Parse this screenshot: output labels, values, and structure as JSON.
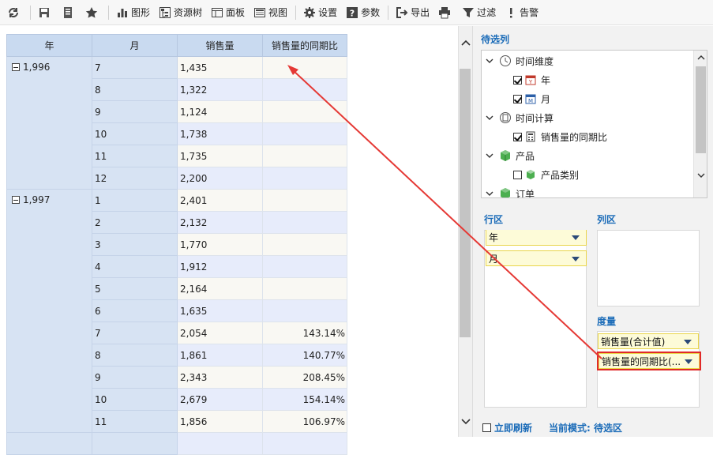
{
  "toolbar": {
    "items": [
      {
        "icon": "refresh-icon",
        "label": ""
      },
      {
        "icon": "save-icon",
        "label": ""
      },
      {
        "icon": "save-as-icon",
        "label": ""
      },
      {
        "icon": "star-icon",
        "label": ""
      },
      {
        "icon": "chart-icon",
        "label": "图形"
      },
      {
        "icon": "resource-tree-icon",
        "label": "资源树"
      },
      {
        "icon": "panel-icon",
        "label": "面板"
      },
      {
        "icon": "view-icon",
        "label": "视图"
      },
      {
        "icon": "gear-icon",
        "label": "设置"
      },
      {
        "icon": "help-icon",
        "label": "参数"
      },
      {
        "icon": "export-icon",
        "label": "导出"
      },
      {
        "icon": "print-icon",
        "label": ""
      },
      {
        "icon": "filter-icon",
        "label": "过滤"
      },
      {
        "icon": "alert-icon",
        "label": "告警"
      }
    ]
  },
  "grid": {
    "headers": [
      "年",
      "月",
      "销售量",
      "销售量的同期比"
    ],
    "groups": [
      {
        "year": "1,996",
        "rows": [
          {
            "month": "7",
            "sales": "1,435",
            "yoy": ""
          },
          {
            "month": "8",
            "sales": "1,322",
            "yoy": ""
          },
          {
            "month": "9",
            "sales": "1,124",
            "yoy": ""
          },
          {
            "month": "10",
            "sales": "1,738",
            "yoy": ""
          },
          {
            "month": "11",
            "sales": "1,735",
            "yoy": ""
          },
          {
            "month": "12",
            "sales": "2,200",
            "yoy": ""
          }
        ]
      },
      {
        "year": "1,997",
        "rows": [
          {
            "month": "1",
            "sales": "2,401",
            "yoy": ""
          },
          {
            "month": "2",
            "sales": "2,132",
            "yoy": ""
          },
          {
            "month": "3",
            "sales": "1,770",
            "yoy": ""
          },
          {
            "month": "4",
            "sales": "1,912",
            "yoy": ""
          },
          {
            "month": "5",
            "sales": "2,164",
            "yoy": ""
          },
          {
            "month": "6",
            "sales": "1,635",
            "yoy": ""
          },
          {
            "month": "7",
            "sales": "2,054",
            "yoy": "143.14%"
          },
          {
            "month": "8",
            "sales": "1,861",
            "yoy": "140.77%"
          },
          {
            "month": "9",
            "sales": "2,343",
            "yoy": "208.45%"
          },
          {
            "month": "10",
            "sales": "2,679",
            "yoy": "154.14%"
          },
          {
            "month": "11",
            "sales": "1,856",
            "yoy": "106.97%"
          }
        ]
      }
    ]
  },
  "panel": {
    "title": "待选列",
    "tree": {
      "time_dim": "时间维度",
      "year": "年",
      "month": "月",
      "time_calc": "时间计算",
      "yoy_field": "销售量的同期比",
      "product": "产品",
      "product_cat": "产品类别",
      "order": "订单"
    },
    "row_zone_label": "行区",
    "col_zone_label": "列区",
    "measure_zone_label": "度量",
    "row_chips": [
      "年",
      "月"
    ],
    "measure_chips": [
      "销售量(合计值)",
      "销售量的同期比(..."
    ],
    "refresh_label": "立即刷新",
    "mode_label": "当前模式: 待选区"
  },
  "colors": {
    "header_bg": "#c9daf0",
    "dim_bg": "#d7e3f3",
    "accent": "#1a6bb8",
    "highlight": "#e02a2a",
    "chip_bg": "#fdfbd8"
  }
}
